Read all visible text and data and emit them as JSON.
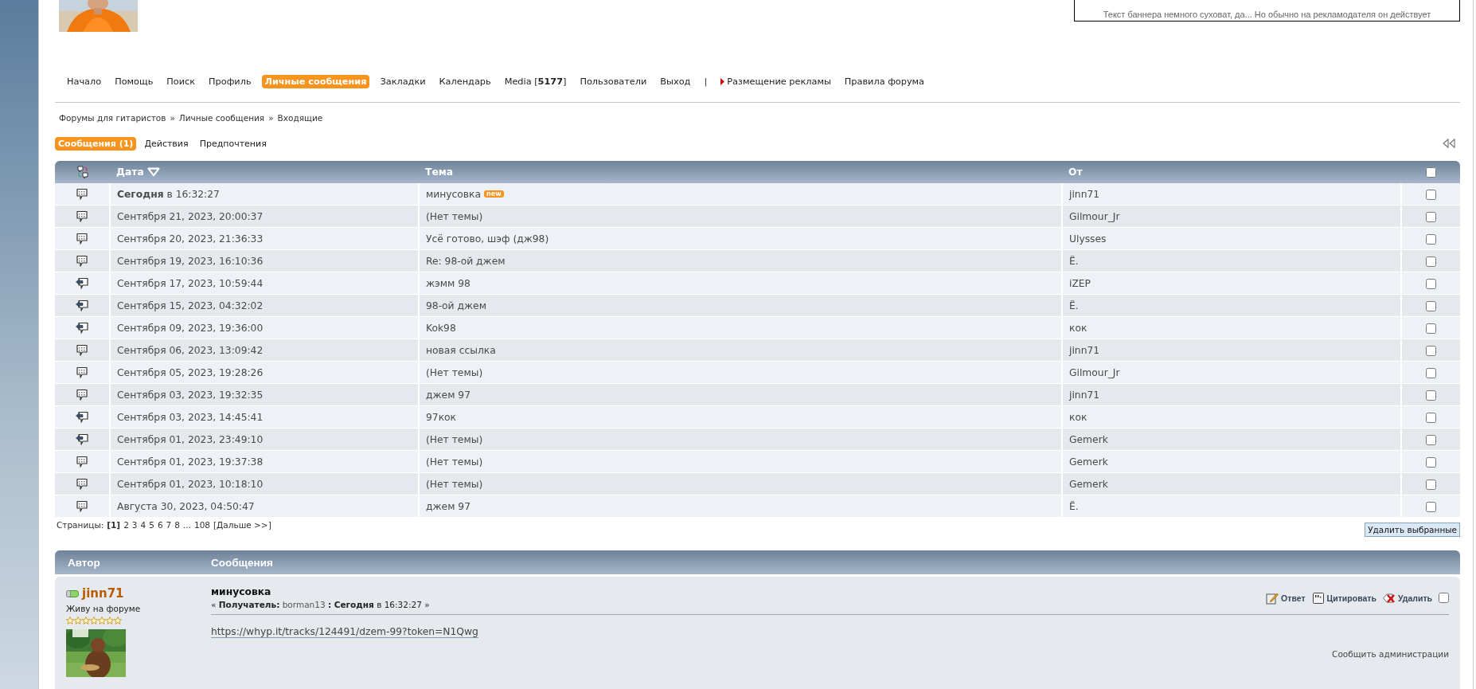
{
  "banner": {
    "text": "Текст баннера немного суховат, да... Но обычно на рекламодателя он действует"
  },
  "nav": [
    {
      "kind": "link",
      "label": "Начало",
      "selected": false
    },
    {
      "kind": "link",
      "label": "Помощь",
      "selected": false
    },
    {
      "kind": "link",
      "label": "Поиск",
      "selected": false
    },
    {
      "kind": "link",
      "label": "Профиль",
      "selected": false
    },
    {
      "kind": "link",
      "label": "Личные сообщения",
      "selected": true
    },
    {
      "kind": "link",
      "label": "Закладки",
      "selected": false
    },
    {
      "kind": "link",
      "label": "Календарь",
      "selected": false
    },
    {
      "kind": "link",
      "label": "Media [**5177**]",
      "selected": false
    },
    {
      "kind": "link",
      "label": "Пользователи",
      "selected": false
    },
    {
      "kind": "link",
      "label": "Выход",
      "selected": false
    },
    {
      "kind": "separator",
      "label": "|"
    },
    {
      "kind": "promo",
      "label": "Размещение рекламы",
      "selected": false
    },
    {
      "kind": "link",
      "label": "Правила форума",
      "selected": false
    }
  ],
  "breadcrumb": [
    "Форумы для гитаристов",
    "Личные сообщения",
    "Входящие"
  ],
  "breadcrumb_separator": "»",
  "subtabs": [
    {
      "label": "Сообщения (1)",
      "selected": true
    },
    {
      "label": "Действия",
      "selected": false
    },
    {
      "label": "Предпочтения",
      "selected": false
    }
  ],
  "table": {
    "columns": [
      "Дата",
      "Тема",
      "От"
    ],
    "select_all_checked": false,
    "rows": [
      {
        "kind": "message",
        "date": "**Сегодня** в 16:32:27",
        "subject": "минусовка",
        "badge": "new",
        "from": "jinn71",
        "checked": false
      },
      {
        "kind": "message",
        "date": "Сентября 21, 2023, 20:00:37",
        "subject": "(Нет темы)",
        "from": "Gilmour_Jr",
        "checked": false
      },
      {
        "kind": "message",
        "date": "Сентября 20, 2023, 21:36:33",
        "subject": "Усё готово, шэф (дж98)",
        "from": "Ulysses",
        "checked": false
      },
      {
        "kind": "message",
        "date": "Сентября 19, 2023, 16:10:36",
        "subject": "Re: 98-ой джем",
        "from": "Ё.",
        "checked": false
      },
      {
        "kind": "replied",
        "date": "Сентября 17, 2023, 10:59:44",
        "subject": "жэмм 98",
        "from": "iZEP",
        "checked": false
      },
      {
        "kind": "replied",
        "date": "Сентября 15, 2023, 04:32:02",
        "subject": "98-ой джем",
        "from": "Ё.",
        "checked": false
      },
      {
        "kind": "replied",
        "date": "Сентября 09, 2023, 19:36:00",
        "subject": "Kok98",
        "from": "кок",
        "checked": false
      },
      {
        "kind": "message",
        "date": "Сентября 06, 2023, 13:09:42",
        "subject": "новая ссылка",
        "from": "jinn71",
        "checked": false
      },
      {
        "kind": "message",
        "date": "Сентября 05, 2023, 19:28:26",
        "subject": "(Нет темы)",
        "from": "Gilmour_Jr",
        "checked": false
      },
      {
        "kind": "message",
        "date": "Сентября 03, 2023, 19:32:35",
        "subject": "джем 97",
        "from": "jinn71",
        "checked": false
      },
      {
        "kind": "replied",
        "date": "Сентября 03, 2023, 14:45:41",
        "subject": "97кок",
        "from": "кок",
        "checked": false
      },
      {
        "kind": "replied",
        "date": "Сентября 01, 2023, 23:49:10",
        "subject": "(Нет темы)",
        "from": "Gemerk",
        "checked": false
      },
      {
        "kind": "message",
        "date": "Сентября 01, 2023, 19:37:38",
        "subject": "(Нет темы)",
        "from": "Gemerk",
        "checked": false
      },
      {
        "kind": "message",
        "date": "Сентября 01, 2023, 10:18:10",
        "subject": "(Нет темы)",
        "from": "Gemerk",
        "checked": false
      },
      {
        "kind": "message",
        "date": "Августа 30, 2023, 04:50:47",
        "subject": "джем 97",
        "from": "Ё.",
        "checked": false
      }
    ]
  },
  "pagination": {
    "label": "Страницы:",
    "pages": [
      {
        "label": "[1]",
        "selected": true
      },
      {
        "label": "2",
        "selected": false
      },
      {
        "label": "3",
        "selected": false
      },
      {
        "label": "4",
        "selected": false
      },
      {
        "label": "5",
        "selected": false
      },
      {
        "label": "6",
        "selected": false
      },
      {
        "label": "7",
        "selected": false
      },
      {
        "label": "8",
        "selected": false
      }
    ],
    "ellipsis": "...",
    "last": "108",
    "next": "[Дальше >>]"
  },
  "delete_selected": "Удалить выбранные",
  "post_header": [
    "Автор",
    "Сообщения"
  ],
  "post": {
    "author": "jinn71",
    "online": true,
    "author_title": "Живу на форуме",
    "stars": 7,
    "title": "минусовка",
    "meta_prefix": "« **Получатель:**",
    "recipient": "borman13",
    "meta_suffix": "**: Сегодня** в 16:32:27 »",
    "actions": [
      {
        "kind": "reply",
        "label": "Ответ"
      },
      {
        "kind": "quote",
        "label": "Цитировать"
      },
      {
        "kind": "delete",
        "label": "Удалить"
      }
    ],
    "checked": false,
    "body_link": "https://whyp.it/tracks/124491/dzem-99?token=N1Qwg",
    "report": "Сообщить администрации"
  }
}
